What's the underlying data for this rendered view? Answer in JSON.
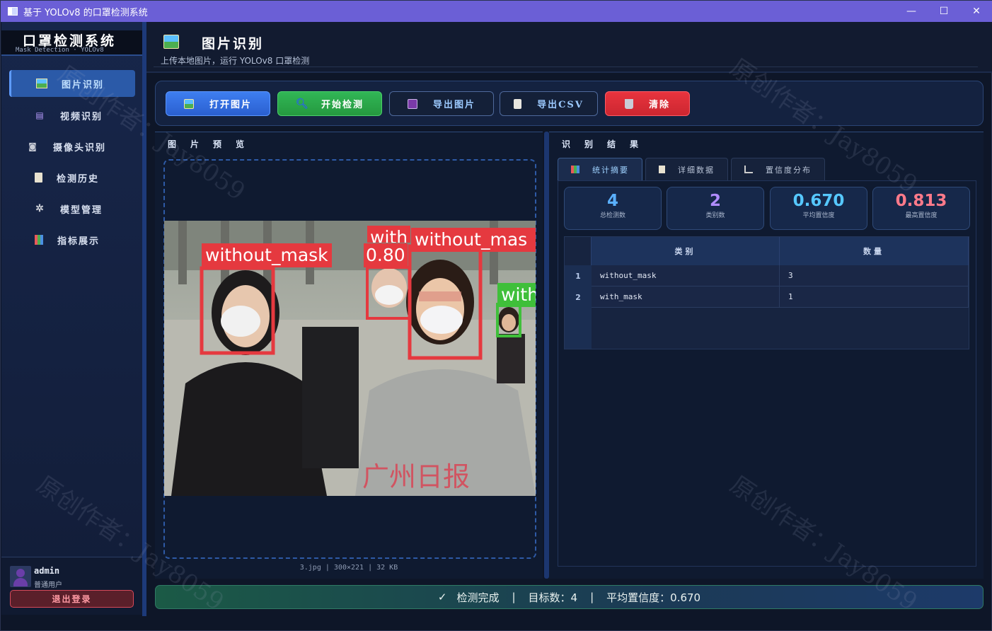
{
  "window": {
    "title": "基于 YOLOv8 的口罩检测系统"
  },
  "brand": {
    "title": "口罩检测系统",
    "subtitle": "Mask Detection  ·  YOLOv8"
  },
  "sidebar": {
    "items": [
      {
        "label": "图片识别",
        "icon": "image-icon"
      },
      {
        "label": "视频识别",
        "icon": "film-icon"
      },
      {
        "label": "摄像头识别",
        "icon": "camera-icon"
      },
      {
        "label": "检测历史",
        "icon": "history-icon"
      },
      {
        "label": "模型管理",
        "icon": "gear-icon"
      },
      {
        "label": "指标展示",
        "icon": "chart-icon"
      }
    ]
  },
  "user": {
    "name": "admin",
    "role": "普通用户",
    "logout": "退出登录"
  },
  "header": {
    "title": "图片识别",
    "subtitle": "上传本地图片，运行 YOLOv8 口罩检测"
  },
  "toolbar": {
    "open": "打开图片",
    "detect": "开始检测",
    "export_img": "导出图片",
    "export_csv": "导出CSV",
    "clear": "清除"
  },
  "preview": {
    "title": "图片预览",
    "fileinfo": "3.jpg  |  300×221  |  32 KB",
    "labels": [
      "without_mask",
      "0.80",
      "with",
      "without_mas",
      "with"
    ],
    "watermark_text": "广州日报"
  },
  "results": {
    "title": "识别结果",
    "tabs": [
      "统计摘要",
      "详细数据",
      "置信度分布"
    ],
    "cards": [
      {
        "value": "4",
        "label": "总检测数",
        "color": "#5ab0ff"
      },
      {
        "value": "2",
        "label": "类别数",
        "color": "#b08cff"
      },
      {
        "value": "0.670",
        "label": "平均置信度",
        "color": "#56c8ff"
      },
      {
        "value": "0.813",
        "label": "最高置信度",
        "color": "#ff7a8a"
      }
    ],
    "table": {
      "headers": [
        "类别",
        "数量"
      ],
      "rows": [
        {
          "n": "1",
          "cls": "without_mask",
          "count": "3"
        },
        {
          "n": "2",
          "cls": "with_mask",
          "count": "1"
        }
      ]
    }
  },
  "status": {
    "check": "✓",
    "done": "检测完成",
    "sep1": "|",
    "targets": "目标数：4",
    "sep2": "|",
    "conf": "平均置信度：0.670"
  },
  "watermark": "原创作者：Jay8059"
}
